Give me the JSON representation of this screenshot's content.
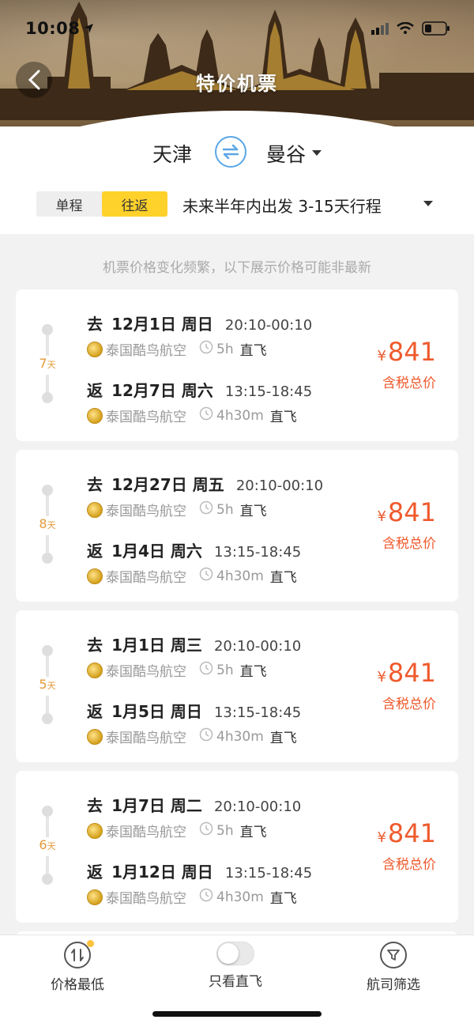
{
  "status": {
    "time": "10:08"
  },
  "header": {
    "title": "特价机票"
  },
  "route": {
    "from": "天津",
    "to": "曼谷"
  },
  "mode": {
    "one_way": "单程",
    "round_trip": "往返",
    "active": "往返",
    "range": "未来半年内出发 3-15天行程"
  },
  "notice": "机票价格变化频繁，以下展示价格可能非最新",
  "accent": "#ffd12b",
  "price_color": "#ef5a2d",
  "trips": [
    {
      "days": "7",
      "days_unit": "天",
      "out": {
        "label": "去",
        "date": "12月1日 周日",
        "time": "20:10-00:10",
        "airline": "泰国酷鸟航空",
        "duration": "5h",
        "type": "直飞"
      },
      "ret": {
        "label": "返",
        "date": "12月7日 周六",
        "time": "13:15-18:45",
        "airline": "泰国酷鸟航空",
        "duration": "4h30m",
        "type": "直飞"
      },
      "currency": "¥",
      "price": "841",
      "price_note": "含税总价"
    },
    {
      "days": "8",
      "days_unit": "天",
      "out": {
        "label": "去",
        "date": "12月27日 周五",
        "time": "20:10-00:10",
        "airline": "泰国酷鸟航空",
        "duration": "5h",
        "type": "直飞"
      },
      "ret": {
        "label": "返",
        "date": "1月4日 周六",
        "time": "13:15-18:45",
        "airline": "泰国酷鸟航空",
        "duration": "4h30m",
        "type": "直飞"
      },
      "currency": "¥",
      "price": "841",
      "price_note": "含税总价"
    },
    {
      "days": "5",
      "days_unit": "天",
      "out": {
        "label": "去",
        "date": "1月1日 周三",
        "time": "20:10-00:10",
        "airline": "泰国酷鸟航空",
        "duration": "5h",
        "type": "直飞"
      },
      "ret": {
        "label": "返",
        "date": "1月5日 周日",
        "time": "13:15-18:45",
        "airline": "泰国酷鸟航空",
        "duration": "4h30m",
        "type": "直飞"
      },
      "currency": "¥",
      "price": "841",
      "price_note": "含税总价"
    },
    {
      "days": "6",
      "days_unit": "天",
      "out": {
        "label": "去",
        "date": "1月7日 周二",
        "time": "20:10-00:10",
        "airline": "泰国酷鸟航空",
        "duration": "5h",
        "type": "直飞"
      },
      "ret": {
        "label": "返",
        "date": "1月12日 周日",
        "time": "13:15-18:45",
        "airline": "泰国酷鸟航空",
        "duration": "4h30m",
        "type": "直飞"
      },
      "currency": "¥",
      "price": "841",
      "price_note": "含税总价"
    }
  ],
  "bottom": {
    "sort_label": "价格最低",
    "direct_label": "只看直飞",
    "airline_label": "航司筛选"
  }
}
